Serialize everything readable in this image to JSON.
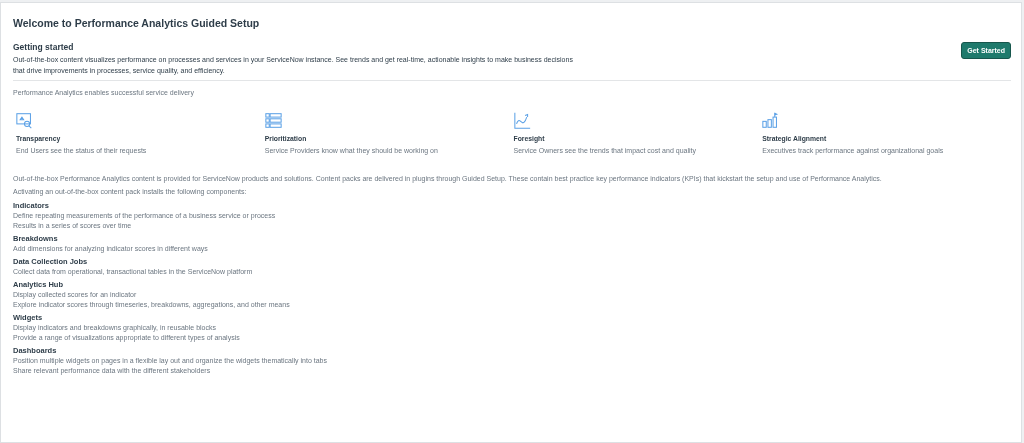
{
  "page": {
    "title": "Welcome to Performance Analytics Guided Setup"
  },
  "getting_started": {
    "heading": "Getting started",
    "description": "Out-of-the-box content visualizes performance on processes and services in your ServiceNow instance. See trends and get real-time, actionable insights to make business decisions that drive improvements in processes, service quality, and efficiency.",
    "button": "Get Started"
  },
  "benefits_intro": "Performance Analytics enables successful service delivery",
  "benefits": [
    {
      "kind": "search",
      "title": "Transparency",
      "description": "End Users see the status of their requests"
    },
    {
      "kind": "list",
      "title": "Prioritization",
      "description": "Service Providers know what they should be working on"
    },
    {
      "kind": "trend",
      "title": "Foresight",
      "description": "Service Owners see the trends that impact cost and quality"
    },
    {
      "kind": "goal",
      "title": "Strategic Alignment",
      "description": "Executives track performance against organizational goals"
    }
  ],
  "content_intro": [
    "Out-of-the-box Performance Analytics content is provided for ServiceNow products and solutions. Content packs are delivered in plugins through Guided Setup. These contain best practice key performance indicators (KPIs) that kickstart the setup and use of Performance Analytics.",
    "Activating an out-of-the-box content pack installs the following components:"
  ],
  "components": [
    {
      "title": "Indicators",
      "lines": [
        "Define repeating measurements of the performance of a business service or process",
        "Results in a series of scores over time"
      ]
    },
    {
      "title": "Breakdowns",
      "lines": [
        "Add dimensions for analyzing indicator scores in different ways"
      ]
    },
    {
      "title": "Data Collection Jobs",
      "lines": [
        "Collect data from operational, transactional tables in the ServiceNow platform"
      ]
    },
    {
      "title": "Analytics Hub",
      "lines": [
        "Display collected scores for an indicator",
        "Explore indicator scores through timeseries, breakdowns, aggregations, and other means"
      ]
    },
    {
      "title": "Widgets",
      "lines": [
        "Display indicators and breakdowns graphically, in reusable blocks",
        "Provide a range of visualizations appropriate to different types of analysis"
      ]
    },
    {
      "title": "Dashboards",
      "lines": [
        "Position multiple widgets on pages in a flexible lay out and organize the widgets thematically into tabs",
        "Share relevant performance data with the different stakeholders"
      ]
    }
  ]
}
